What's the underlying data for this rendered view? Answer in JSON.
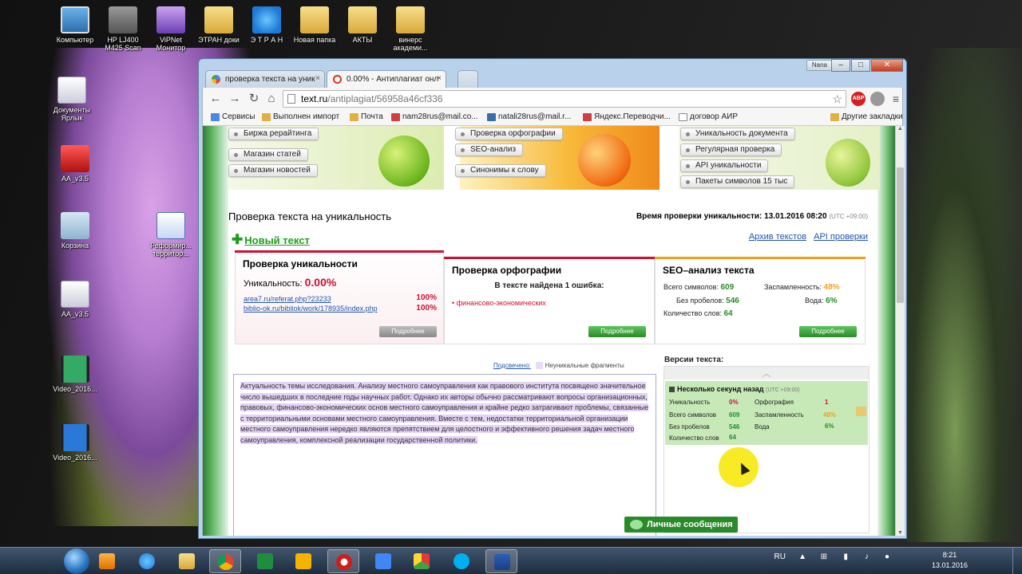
{
  "desktop": {
    "icons": [
      {
        "label": "Компьютер",
        "icon": "computer-icon"
      },
      {
        "label": "HP LJ400 M425 Scan",
        "icon": "printer-icon"
      },
      {
        "label": "ViPNet Монитор",
        "icon": "vipnet-icon"
      },
      {
        "label": "ЭТРАН доки",
        "icon": "folder-icon"
      },
      {
        "label": "Э Т Р А Н",
        "icon": "ie-icon"
      },
      {
        "label": "Новая папка",
        "icon": "folder-icon"
      },
      {
        "label": "АКТЫ",
        "icon": "folder-icon"
      },
      {
        "label": "винерс академи...",
        "icon": "folder-icon"
      },
      {
        "label": "Документы Ярлык",
        "icon": "documents-icon"
      },
      {
        "label": "AA_v3.5",
        "icon": "app-icon"
      },
      {
        "label": "Корзина",
        "icon": "recycle-bin-icon"
      },
      {
        "label": "Реформир... территор...",
        "icon": "word-doc-icon"
      },
      {
        "label": "AA_v3.5",
        "icon": "file-icon"
      },
      {
        "label": "Video_2016...",
        "icon": "video-icon"
      },
      {
        "label": "Video_2016...",
        "icon": "video-icon"
      }
    ]
  },
  "window": {
    "user_badge": "Nana",
    "controls": {
      "minimize": "–",
      "maximize": "□",
      "close": "✕"
    }
  },
  "tabs": [
    {
      "title": "проверка текста на уник",
      "close": "×"
    },
    {
      "title": "0.00% - Антиплагиат онл",
      "close": "×"
    }
  ],
  "toolbar": {
    "back": "←",
    "forward": "→",
    "reload": "↻",
    "home": "⌂",
    "url_host": "text.ru",
    "url_path": "/antiplagiat/56958a46cf336",
    "star": "☆",
    "abp": "ABP",
    "menu": "≡"
  },
  "bookmarks": [
    {
      "label": "Сервисы",
      "color": "#4a86e8"
    },
    {
      "label": "Выполнен импорт",
      "color": "#e0b040"
    },
    {
      "label": "Почта",
      "color": "#e0b040"
    },
    {
      "label": "nam28rus@mail.co...",
      "color": "#d04040"
    },
    {
      "label": "natali28rus@mail.r...",
      "color": "#3a6ea8"
    },
    {
      "label": "Яндекс.Переводчи...",
      "color": "#d04040"
    },
    {
      "label": "договор АИР",
      "color": "#888888"
    },
    {
      "label": "Другие закладки",
      "color": "#e0b040"
    }
  ],
  "banner": {
    "menu_left": [
      "Биржа рерайтинга",
      "Магазин статей",
      "Магазин новостей"
    ],
    "menu_mid": [
      "Проверка орфографии",
      "SEO-анализ",
      "Синонимы к слову"
    ],
    "menu_right": [
      "Уникальность документа",
      "Регулярная проверка",
      "API уникальности",
      "Пакеты символов 15 тыс"
    ]
  },
  "page": {
    "title": "Проверка текста на уникальность",
    "check_time_label": "Время проверки уникальности: 13.01.2016 08:20",
    "check_time_tz": "(UTC +09:00)",
    "new_text": "Новый текст",
    "archive_link": "Архив текстов",
    "api_link": "API проверки"
  },
  "cards": {
    "uniqueness": {
      "title": "Проверка уникальности",
      "label": "Уникальность:",
      "value": "0.00%",
      "sources": [
        {
          "url": "area7.ru/referat.php?23233",
          "pct": "100%"
        },
        {
          "url": "biblio-ok.ru/bibliok/work/178935/index.php",
          "pct": "100%"
        }
      ],
      "button": "Подробнее",
      "accent": "#cc1133"
    },
    "spelling": {
      "title": "Проверка орфографии",
      "subtitle": "В тексте найдена 1 ошибка:",
      "error_word": "финансово-экономических",
      "button": "Подробнее",
      "accent": "#cc1133"
    },
    "seo": {
      "title": "SEO–анализ текста",
      "chars_label": "Всего символов:",
      "chars": "609",
      "spam_label": "Заспамленность:",
      "spam": "48%",
      "nospace_label": "Без пробелов:",
      "nospace": "546",
      "water_label": "Вода:",
      "water": "6%",
      "words_label": "Количество слов:",
      "words": "64",
      "button": "Подробнее",
      "accent": "#f0a020"
    }
  },
  "editor": {
    "checked_link": "Подсвечено:",
    "legend": "Неуникальные фрагменты",
    "text": "Актуальность темы исследования. Анализу местного самоуправления как правового института посвящено значительное число вышедших в последние годы научных работ. Однако их авторы обычно рассматривают вопросы организационных, правовых, финансово-экономических основ местного самоуправления и крайне редко затрагивают проблемы, связанные с территориальными основами местного самоуправления. Вместе с тем, недостатки территориальной организации местного самоуправления нередко являются препятствием для целостного и эффективного решения задач местного самоуправления, комплексной реализации государственной политики."
  },
  "versions": {
    "label": "Версии текста:",
    "up": "︿",
    "item": {
      "time": "Несколько секунд назад",
      "tz": "(UTC +09:00)",
      "uniq_label": "Уникальность",
      "uniq": "0%",
      "spell_label": "Орфография",
      "spell": "1",
      "chars_label": "Всего символов",
      "chars": "609",
      "spam_label": "Заспамленность",
      "spam": "48%",
      "nospace_label": "Без пробелов",
      "nospace": "546",
      "water_label": "Вода",
      "water": "6%",
      "words_label": "Количество слов",
      "words": "64"
    }
  },
  "messages_button": "Личные сообщения",
  "taskbar": {
    "apps": [
      "media-player",
      "internet-explorer",
      "file-explorer",
      "chrome",
      "excel",
      "powerpoint",
      "opera",
      "docs",
      "paint",
      "skype",
      "word"
    ],
    "lang": "RU",
    "time": "8:21",
    "date": "13.01.2016"
  }
}
